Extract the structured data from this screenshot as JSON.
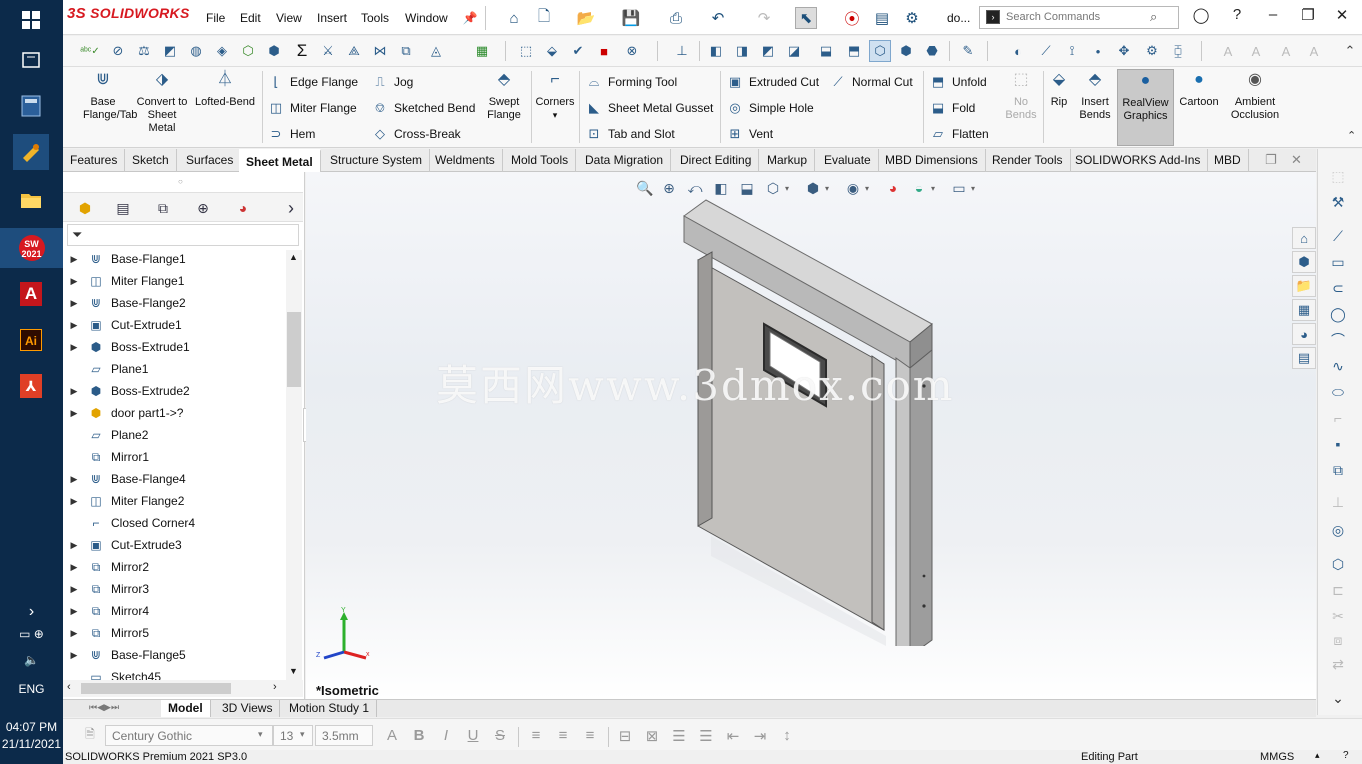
{
  "app": {
    "name": "SOLIDWORKS",
    "doc_short": "do..."
  },
  "menu": [
    "File",
    "Edit",
    "View",
    "Insert",
    "Tools",
    "Window"
  ],
  "search": {
    "placeholder": "Search Commands"
  },
  "taskbar": {
    "time": "04:07 PM",
    "date": "21/11/2021",
    "lang": "ENG",
    "sw_badge": "2021"
  },
  "ribbon": {
    "big": [
      "Base Flange/Tab",
      "Convert to Sheet Metal",
      "Lofted-Bend",
      "Swept Flange",
      "Corners",
      "No Bends",
      "Rip",
      "Insert Bends",
      "RealView Graphics",
      "Cartoon",
      "Ambient Occlusion"
    ],
    "col1": [
      "Edge Flange",
      "Miter Flange",
      "Hem"
    ],
    "col2": [
      "Jog",
      "Sketched Bend",
      "Cross-Break"
    ],
    "col3": [
      "Forming Tool",
      "Sheet Metal Gusset",
      "Tab and Slot"
    ],
    "col4": [
      "Extruded Cut",
      "Simple Hole",
      "Vent"
    ],
    "col5": [
      "Normal Cut"
    ],
    "col6": [
      "Unfold",
      "Fold",
      "Flatten"
    ]
  },
  "tabs": [
    "Features",
    "Sketch",
    "Surfaces",
    "Sheet Metal",
    "Structure System",
    "Weldments",
    "Mold Tools",
    "Data Migration",
    "Direct Editing",
    "Markup",
    "Evaluate",
    "MBD Dimensions",
    "Render Tools",
    "SOLIDWORKS Add-Ins",
    "MBD"
  ],
  "active_tab": "Sheet Metal",
  "tree": [
    {
      "label": "Base-Flange1",
      "icon": "base-flange-icon",
      "exp": true
    },
    {
      "label": "Miter Flange1",
      "icon": "miter-flange-icon",
      "exp": true
    },
    {
      "label": "Base-Flange2",
      "icon": "base-flange-icon",
      "exp": true
    },
    {
      "label": "Cut-Extrude1",
      "icon": "cut-extrude-icon",
      "exp": true
    },
    {
      "label": "Boss-Extrude1",
      "icon": "boss-extrude-icon",
      "exp": true
    },
    {
      "label": "Plane1",
      "icon": "plane-icon",
      "exp": false
    },
    {
      "label": "Boss-Extrude2",
      "icon": "boss-extrude-icon",
      "exp": true
    },
    {
      "label": "door part1->?",
      "icon": "part-icon",
      "exp": true
    },
    {
      "label": "Plane2",
      "icon": "plane-icon",
      "exp": false
    },
    {
      "label": "Mirror1",
      "icon": "mirror-icon",
      "exp": false
    },
    {
      "label": "Base-Flange4",
      "icon": "base-flange-icon",
      "exp": true
    },
    {
      "label": "Miter Flange2",
      "icon": "miter-flange-icon",
      "exp": true
    },
    {
      "label": "Closed Corner4",
      "icon": "closed-corner-icon",
      "exp": false
    },
    {
      "label": "Cut-Extrude3",
      "icon": "cut-extrude-icon",
      "exp": true
    },
    {
      "label": "Mirror2",
      "icon": "mirror-icon",
      "exp": true
    },
    {
      "label": "Mirror3",
      "icon": "mirror-icon",
      "exp": true
    },
    {
      "label": "Mirror4",
      "icon": "mirror-icon",
      "exp": true
    },
    {
      "label": "Mirror5",
      "icon": "mirror-icon",
      "exp": true
    },
    {
      "label": "Base-Flange5",
      "icon": "base-flange-icon",
      "exp": true
    },
    {
      "label": "Sketch45",
      "icon": "sketch-icon",
      "exp": false
    }
  ],
  "viewport": {
    "view_name": "*Isometric",
    "watermark": "莫西网www.3dmox.com",
    "axis": {
      "x": "x",
      "y": "Y",
      "z": "Z"
    }
  },
  "bottom_tabs": [
    "Model",
    "3D Views",
    "Motion Study 1"
  ],
  "format": {
    "font": "Century Gothic",
    "size": "13",
    "height": "3.5mm"
  },
  "status": {
    "left": "SOLIDWORKS Premium 2021 SP3.0",
    "mode": "Editing Part",
    "units": "MMGS"
  },
  "colors": {
    "brand": "#d71920",
    "taskbar": "#0c2a4a",
    "accent": "#2c5d8a"
  }
}
